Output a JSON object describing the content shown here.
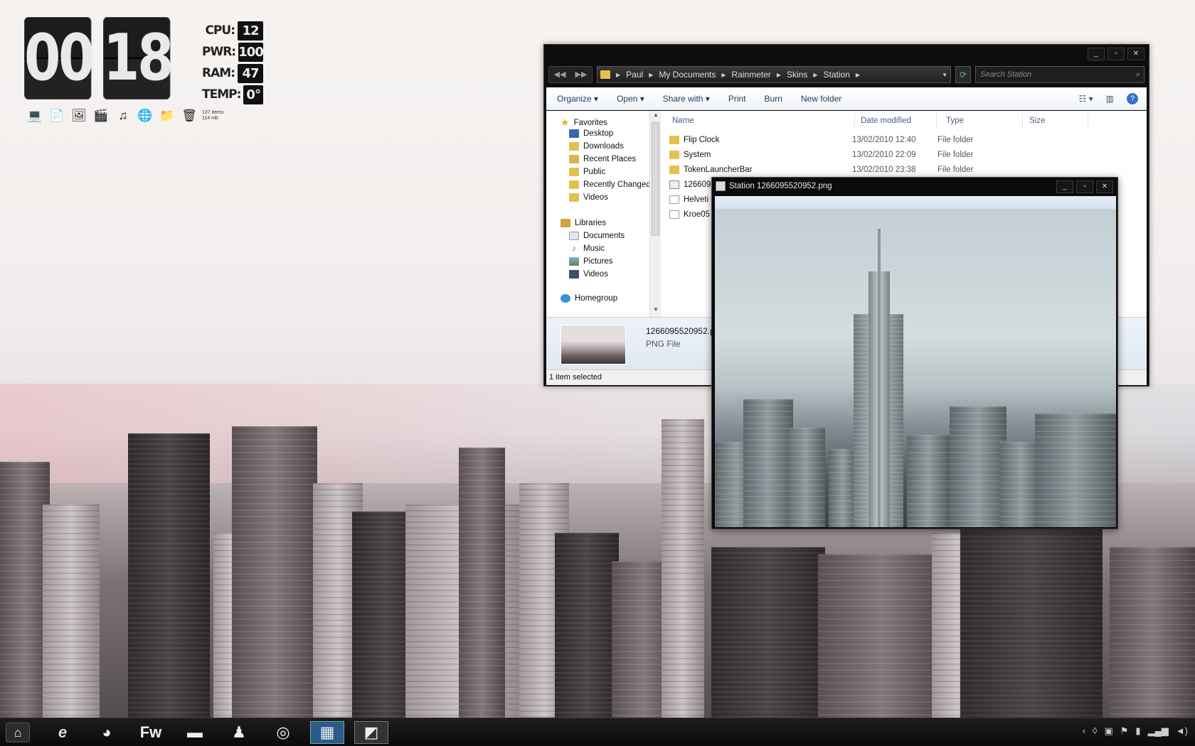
{
  "clock": {
    "hours": "00",
    "minutes": "18"
  },
  "stats": [
    {
      "label": "CPU:",
      "value": "12"
    },
    {
      "label": "PWR:",
      "value": "100"
    },
    {
      "label": "RAM:",
      "value": "47"
    },
    {
      "label": "TEMP:",
      "value": "0°"
    }
  ],
  "launcher": {
    "icons": [
      "laptop-icon",
      "document-icon",
      "pictures-icon",
      "video-icon",
      "music-icon",
      "globe-icon",
      "folder-icon",
      "recycle-bin-icon"
    ],
    "info_line1": "137 items",
    "info_line2": "114 mb"
  },
  "explorer": {
    "window_controls": {
      "minimize": "_",
      "maximize": "▫",
      "close": "✕"
    },
    "breadcrumb": [
      "Paul",
      "My Documents",
      "Rainmeter",
      "Skins",
      "Station"
    ],
    "search_placeholder": "Search Station",
    "commands": {
      "organize": "Organize",
      "open": "Open",
      "share": "Share with",
      "print": "Print",
      "burn": "Burn",
      "new_folder": "New folder"
    },
    "nav_tree": {
      "favorites": "Favorites",
      "favorites_items": [
        "Desktop",
        "Downloads",
        "Recent Places",
        "Public",
        "Recently Changed",
        "Videos"
      ],
      "libraries": "Libraries",
      "libraries_items": [
        "Documents",
        "Music",
        "Pictures",
        "Videos"
      ],
      "homegroup": "Homegroup"
    },
    "columns": {
      "name": "Name",
      "date": "Date modified",
      "type": "Type",
      "size": "Size"
    },
    "files": [
      {
        "name": "Flip Clock",
        "date": "13/02/2010 12:40",
        "type": "File folder"
      },
      {
        "name": "System",
        "date": "13/02/2010 22:09",
        "type": "File folder"
      },
      {
        "name": "TokenLauncherBar",
        "date": "13/02/2010 23:38",
        "type": "File folder"
      },
      {
        "name": "126609",
        "date": "",
        "type": ""
      },
      {
        "name": "Helveti",
        "date": "",
        "type": ""
      },
      {
        "name": "Kroe05",
        "date": "",
        "type": ""
      }
    ],
    "details": {
      "filename": "1266095520952.pn",
      "filetype": "PNG File"
    },
    "status": "1 item selected"
  },
  "viewer": {
    "title": "Station 1266095520952.png"
  },
  "taskbar": {
    "start_icon": "home-icon",
    "apps": [
      "internet-explorer-icon",
      "firefox-icon",
      "fireworks-icon",
      "computer-icon",
      "pidgin-icon",
      "media-player-icon",
      "control-panel-icon",
      "image-viewer-icon"
    ],
    "fireworks_label": "Fw",
    "tray": [
      "chevron-left-icon",
      "drop-icon",
      "network-icon",
      "flag-icon",
      "power-icon",
      "signal-icon",
      "volume-icon"
    ]
  }
}
